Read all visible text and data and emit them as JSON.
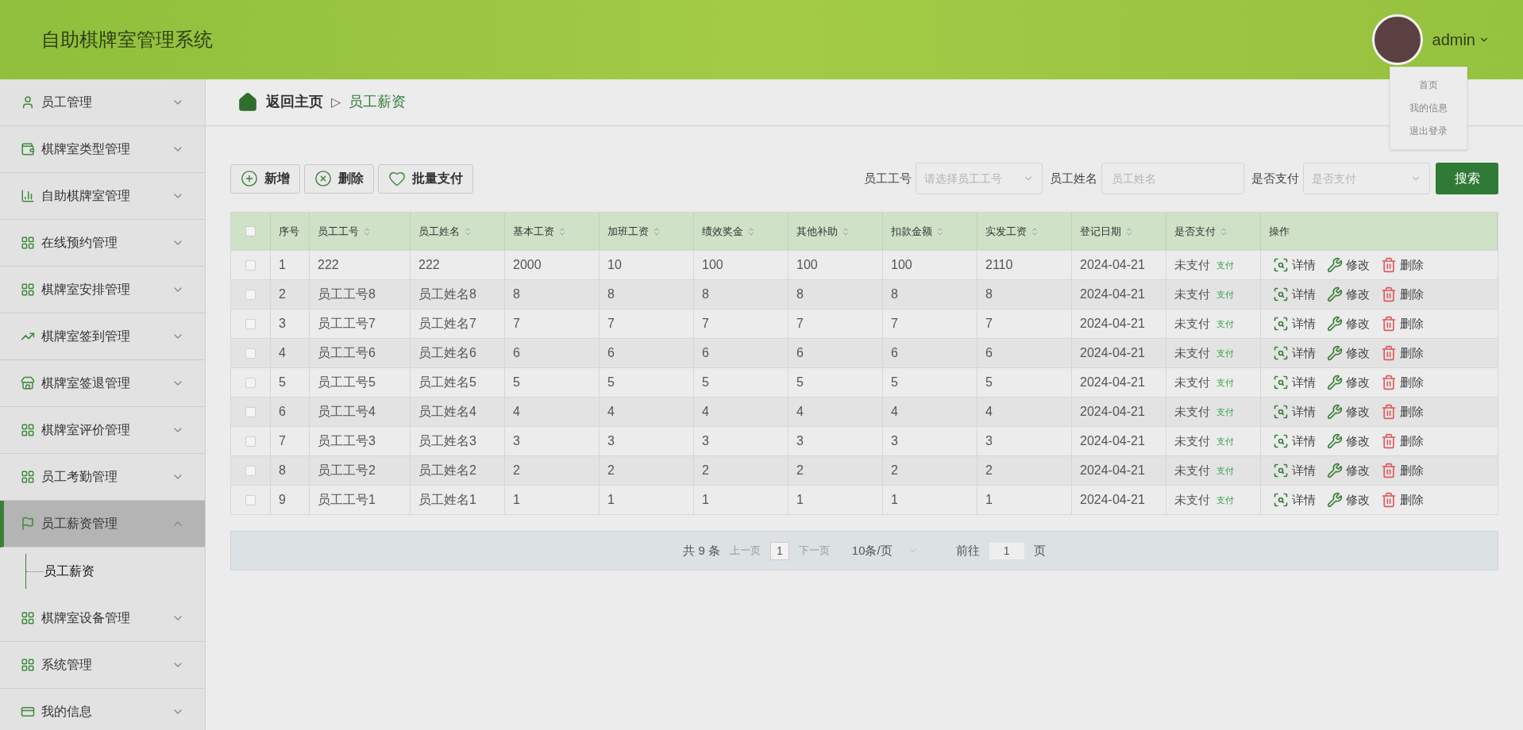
{
  "header": {
    "title": "自助棋牌室管理系统",
    "user": "admin",
    "menu": [
      "首页",
      "我的信息",
      "退出登录"
    ]
  },
  "sidebar": [
    {
      "label": "员工管理",
      "kind": "user",
      "expanded": false,
      "selected": false
    },
    {
      "label": "棋牌室类型管理",
      "kind": "wallet",
      "expanded": false,
      "selected": false
    },
    {
      "label": "自助棋牌室管理",
      "kind": "bars",
      "expanded": false,
      "selected": false
    },
    {
      "label": "在线预约管理",
      "kind": "grid",
      "expanded": false,
      "selected": false
    },
    {
      "label": "棋牌室安排管理",
      "kind": "grid",
      "expanded": false,
      "selected": false
    },
    {
      "label": "棋牌室签到管理",
      "kind": "trend",
      "expanded": false,
      "selected": false
    },
    {
      "label": "棋牌室签退管理",
      "kind": "store",
      "expanded": false,
      "selected": false
    },
    {
      "label": "棋牌室评价管理",
      "kind": "grid",
      "expanded": false,
      "selected": false
    },
    {
      "label": "员工考勤管理",
      "kind": "grid",
      "expanded": false,
      "selected": false
    },
    {
      "label": "员工薪资管理",
      "kind": "flag",
      "expanded": true,
      "selected": true,
      "children": [
        {
          "label": "员工薪资",
          "selected": true
        }
      ]
    },
    {
      "label": "棋牌室设备管理",
      "kind": "grid",
      "expanded": false,
      "selected": false
    },
    {
      "label": "系统管理",
      "kind": "grid",
      "expanded": false,
      "selected": false
    },
    {
      "label": "我的信息",
      "kind": "card",
      "expanded": false,
      "selected": false
    }
  ],
  "breadcrumb": [
    "返回主页",
    "▷",
    "员工薪资"
  ],
  "toolbar": [
    {
      "label": "新增",
      "kind": "add"
    },
    {
      "label": "删除",
      "kind": "delete"
    },
    {
      "label": "批量支付",
      "kind": "heart"
    }
  ],
  "filters": [
    {
      "label": "员工工号",
      "kind": "select",
      "placeholder": "请选择员工工号"
    },
    {
      "label": "员工姓名",
      "kind": "input",
      "placeholder": "员工姓名"
    },
    {
      "label": "是否支付",
      "kind": "select",
      "placeholder": "是否支付"
    }
  ],
  "search_button": "搜索",
  "table": {
    "all_checked": false,
    "columns": [
      {
        "label": "序号",
        "sortable": false
      },
      {
        "label": "员工工号",
        "sortable": true
      },
      {
        "label": "员工姓名",
        "sortable": true
      },
      {
        "label": "基本工资",
        "sortable": true
      },
      {
        "label": "加班工资",
        "sortable": true
      },
      {
        "label": "绩效奖金",
        "sortable": true
      },
      {
        "label": "其他补助",
        "sortable": true
      },
      {
        "label": "扣款金额",
        "sortable": true
      },
      {
        "label": "实发工资",
        "sortable": true
      },
      {
        "label": "登记日期",
        "sortable": true
      },
      {
        "label": "是否支付",
        "sortable": true
      },
      {
        "label": "操作",
        "sortable": false
      }
    ],
    "rows": [
      {
        "checked": false,
        "cells": [
          "1",
          "222",
          "222",
          "2000",
          "10",
          "100",
          "100",
          "100",
          "2110",
          "2024-04-21"
        ],
        "paid": "未支付",
        "pay": "支付",
        "actions": [
          "详情",
          "修改",
          "删除"
        ]
      },
      {
        "checked": false,
        "cells": [
          "2",
          "员工工号8",
          "员工姓名8",
          "8",
          "8",
          "8",
          "8",
          "8",
          "8",
          "2024-04-21"
        ],
        "paid": "未支付",
        "pay": "支付",
        "actions": [
          "详情",
          "修改",
          "删除"
        ]
      },
      {
        "checked": false,
        "cells": [
          "3",
          "员工工号7",
          "员工姓名7",
          "7",
          "7",
          "7",
          "7",
          "7",
          "7",
          "2024-04-21"
        ],
        "paid": "未支付",
        "pay": "支付",
        "actions": [
          "详情",
          "修改",
          "删除"
        ]
      },
      {
        "checked": false,
        "cells": [
          "4",
          "员工工号6",
          "员工姓名6",
          "6",
          "6",
          "6",
          "6",
          "6",
          "6",
          "2024-04-21"
        ],
        "paid": "未支付",
        "pay": "支付",
        "actions": [
          "详情",
          "修改",
          "删除"
        ]
      },
      {
        "checked": false,
        "cells": [
          "5",
          "员工工号5",
          "员工姓名5",
          "5",
          "5",
          "5",
          "5",
          "5",
          "5",
          "2024-04-21"
        ],
        "paid": "未支付",
        "pay": "支付",
        "actions": [
          "详情",
          "修改",
          "删除"
        ]
      },
      {
        "checked": false,
        "cells": [
          "6",
          "员工工号4",
          "员工姓名4",
          "4",
          "4",
          "4",
          "4",
          "4",
          "4",
          "2024-04-21"
        ],
        "paid": "未支付",
        "pay": "支付",
        "actions": [
          "详情",
          "修改",
          "删除"
        ]
      },
      {
        "checked": false,
        "cells": [
          "7",
          "员工工号3",
          "员工姓名3",
          "3",
          "3",
          "3",
          "3",
          "3",
          "3",
          "2024-04-21"
        ],
        "paid": "未支付",
        "pay": "支付",
        "actions": [
          "详情",
          "修改",
          "删除"
        ]
      },
      {
        "checked": false,
        "cells": [
          "8",
          "员工工号2",
          "员工姓名2",
          "2",
          "2",
          "2",
          "2",
          "2",
          "2",
          "2024-04-21"
        ],
        "paid": "未支付",
        "pay": "支付",
        "actions": [
          "详情",
          "修改",
          "删除"
        ]
      },
      {
        "checked": false,
        "cells": [
          "9",
          "员工工号1",
          "员工姓名1",
          "1",
          "1",
          "1",
          "1",
          "1",
          "1",
          "2024-04-21"
        ],
        "paid": "未支付",
        "pay": "支付",
        "actions": [
          "详情",
          "修改",
          "删除"
        ]
      }
    ]
  },
  "pagination": {
    "total": "共 9 条",
    "prev": "上一页",
    "page": "1",
    "next": "下一页",
    "size": "10条/页",
    "goto": "前往",
    "goto_value": "1",
    "unit": "页"
  }
}
